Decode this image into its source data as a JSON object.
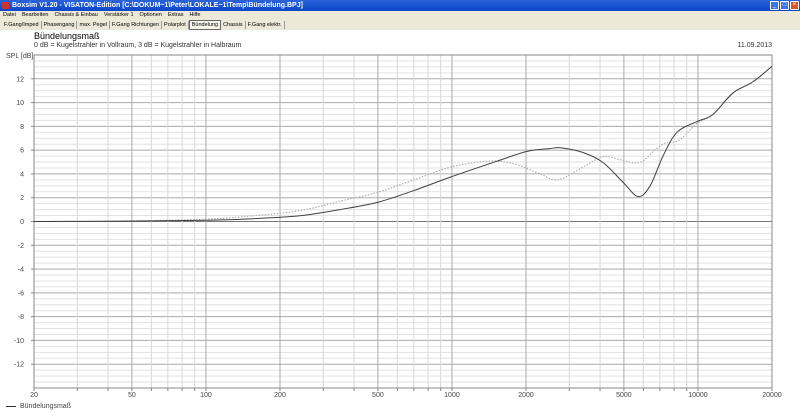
{
  "window": {
    "title": "Boxsim V1.20 - VISATON-Edition [C:\\DOKUM~1\\Peter\\LOKALE~1\\Temp\\Bündelung.BPJ]",
    "buttons": [
      "_",
      "□",
      "×"
    ]
  },
  "menu": [
    "Datei",
    "Bearbeiten",
    "Chassis & Einbau",
    "Verstärker 1",
    "Optionen",
    "Extras",
    "Hilfe"
  ],
  "tabs": [
    {
      "label": "F.Gang/Imped",
      "selected": false
    },
    {
      "label": "Phasengang",
      "selected": false
    },
    {
      "label": "max. Pegel",
      "selected": false
    },
    {
      "label": "F.Gang Richtungen",
      "selected": false
    },
    {
      "label": "Polarplot",
      "selected": false
    },
    {
      "label": "Bündelung",
      "selected": true
    },
    {
      "label": "Chassis",
      "selected": false
    },
    {
      "label": "F.Gang elektr.",
      "selected": false
    }
  ],
  "chart_data": {
    "type": "line",
    "title": "Bündelungsmaß",
    "subtitle": "0 dB = Kugelstrahler in Vollraum, 3 dB = Kugelstrahler in Halbraum",
    "date": "11.09.2013",
    "ylabel": "SPL [dB]",
    "xlabel": "",
    "xscale": "log",
    "xlim": [
      20,
      20000
    ],
    "ylim": [
      -14,
      14
    ],
    "grid": true,
    "xticks": [
      20,
      50,
      100,
      200,
      500,
      1000,
      2000,
      5000,
      10000,
      20000
    ],
    "yticks": [
      12,
      10,
      8,
      6,
      4,
      2,
      0,
      -2,
      -4,
      -6,
      -8,
      -10,
      -12
    ],
    "legend_position": "bottom-left",
    "series": [
      {
        "name": "Bündelungsmaß",
        "color": "#404040",
        "style": "solid",
        "x": [
          20,
          50,
          100,
          150,
          241,
          350,
          500,
          700,
          982,
          1524,
          2020,
          2500,
          2760,
          3410,
          4110,
          4960,
          5710,
          6390,
          7210,
          8220,
          9910,
          11500,
          13870,
          16740,
          20000
        ],
        "y": [
          0,
          0.03,
          0.1,
          0.22,
          0.48,
          1.0,
          1.62,
          2.6,
          3.72,
          5.07,
          5.9,
          6.13,
          6.2,
          5.8,
          4.96,
          3.3,
          2.1,
          3.0,
          5.5,
          7.5,
          8.4,
          9.0,
          10.8,
          11.75,
          13.05
        ]
      },
      {
        "color": "#b0b0b0",
        "style": "dotted",
        "x": [
          20,
          50,
          100,
          150,
          241,
          350,
          500,
          700,
          982,
          1390,
          1770,
          2280,
          2690,
          3330,
          4110,
          4820,
          5780,
          6760,
          7410,
          8340,
          9400,
          10000,
          11500,
          13870,
          16740,
          20000
        ],
        "y": [
          0,
          0.05,
          0.2,
          0.45,
          0.92,
          1.7,
          2.46,
          3.5,
          4.56,
          5.07,
          4.87,
          4.0,
          3.5,
          4.45,
          5.45,
          5.2,
          4.95,
          6.1,
          6.6,
          6.8,
          7.8,
          8.3,
          9.0,
          10.8,
          11.75,
          13.05
        ]
      }
    ]
  }
}
